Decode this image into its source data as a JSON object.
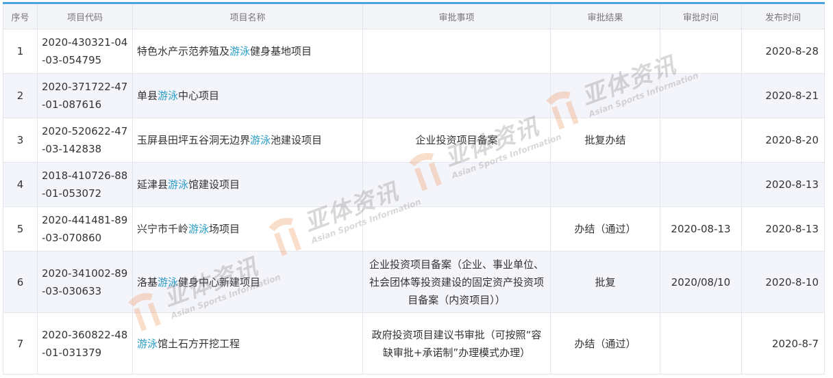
{
  "table": {
    "headers": [
      "序号",
      "项目代码",
      "项目名称",
      "审批事项",
      "审批结果",
      "审批时间",
      "发布时间"
    ],
    "rows": [
      {
        "idx": "1",
        "code_1": "2020-430321-04",
        "code_2": "-03-054795",
        "name_pre": "特色水产示范养殖及",
        "name_hl": "游泳",
        "name_post": "健身基地项目",
        "item": "",
        "result": "",
        "approve_time": "",
        "publish_time": "2020-8-28"
      },
      {
        "idx": "2",
        "code_1": "2020-371722-47",
        "code_2": "-01-087616",
        "name_pre": "单县",
        "name_hl": "游泳",
        "name_post": "中心项目",
        "item": "",
        "result": "",
        "approve_time": "",
        "publish_time": "2020-8-21"
      },
      {
        "idx": "3",
        "code_1": "2020-520622-47",
        "code_2": "-03-142838",
        "name_pre": "玉屏县田坪五谷洞无边界",
        "name_hl": "游泳",
        "name_post": "池建设项目",
        "item": "企业投资项目备案",
        "result": "批复办结",
        "approve_time": "",
        "publish_time": "2020-8-20"
      },
      {
        "idx": "4",
        "code_1": "2018-410726-88",
        "code_2": "-01-053072",
        "name_pre": "延津县",
        "name_hl": "游泳",
        "name_post": "馆建设项目",
        "item": "",
        "result": "",
        "approve_time": "",
        "publish_time": "2020-8-13"
      },
      {
        "idx": "5",
        "code_1": "2020-441481-89",
        "code_2": "-03-070860",
        "name_pre": "兴宁市千岭",
        "name_hl": "游泳",
        "name_post": "场项目",
        "item": "",
        "result": "办结（通过）",
        "approve_time": "2020-08-13",
        "publish_time": "2020-8-13"
      },
      {
        "idx": "6",
        "code_1": "2020-341002-89",
        "code_2": "-03-030633",
        "name_pre": "洛基",
        "name_hl": "游泳",
        "name_post": "健身中心新建项目",
        "item": "企业投资项目备案（企业、事业单位、社会团体等投资建设的固定资产投资项目备案（内资项目））",
        "result": "批复",
        "approve_time": "2020/08/10",
        "publish_time": "2020-8-10"
      },
      {
        "idx": "7",
        "code_1": "2020-360822-48",
        "code_2": "-01-031379",
        "name_pre": "",
        "name_hl": "游泳",
        "name_post": "馆土石方开挖工程",
        "item": "政府投资项目建议书审批（可按照“容缺审批+承诺制”办理模式办理）",
        "result": "办结（通过）",
        "approve_time": "",
        "publish_time": "2020-8-7"
      }
    ]
  },
  "watermark": {
    "cn": "亚体资讯",
    "en": "Asian Sports Information",
    "color": "#f08a4b",
    "text_color": "#777777"
  }
}
